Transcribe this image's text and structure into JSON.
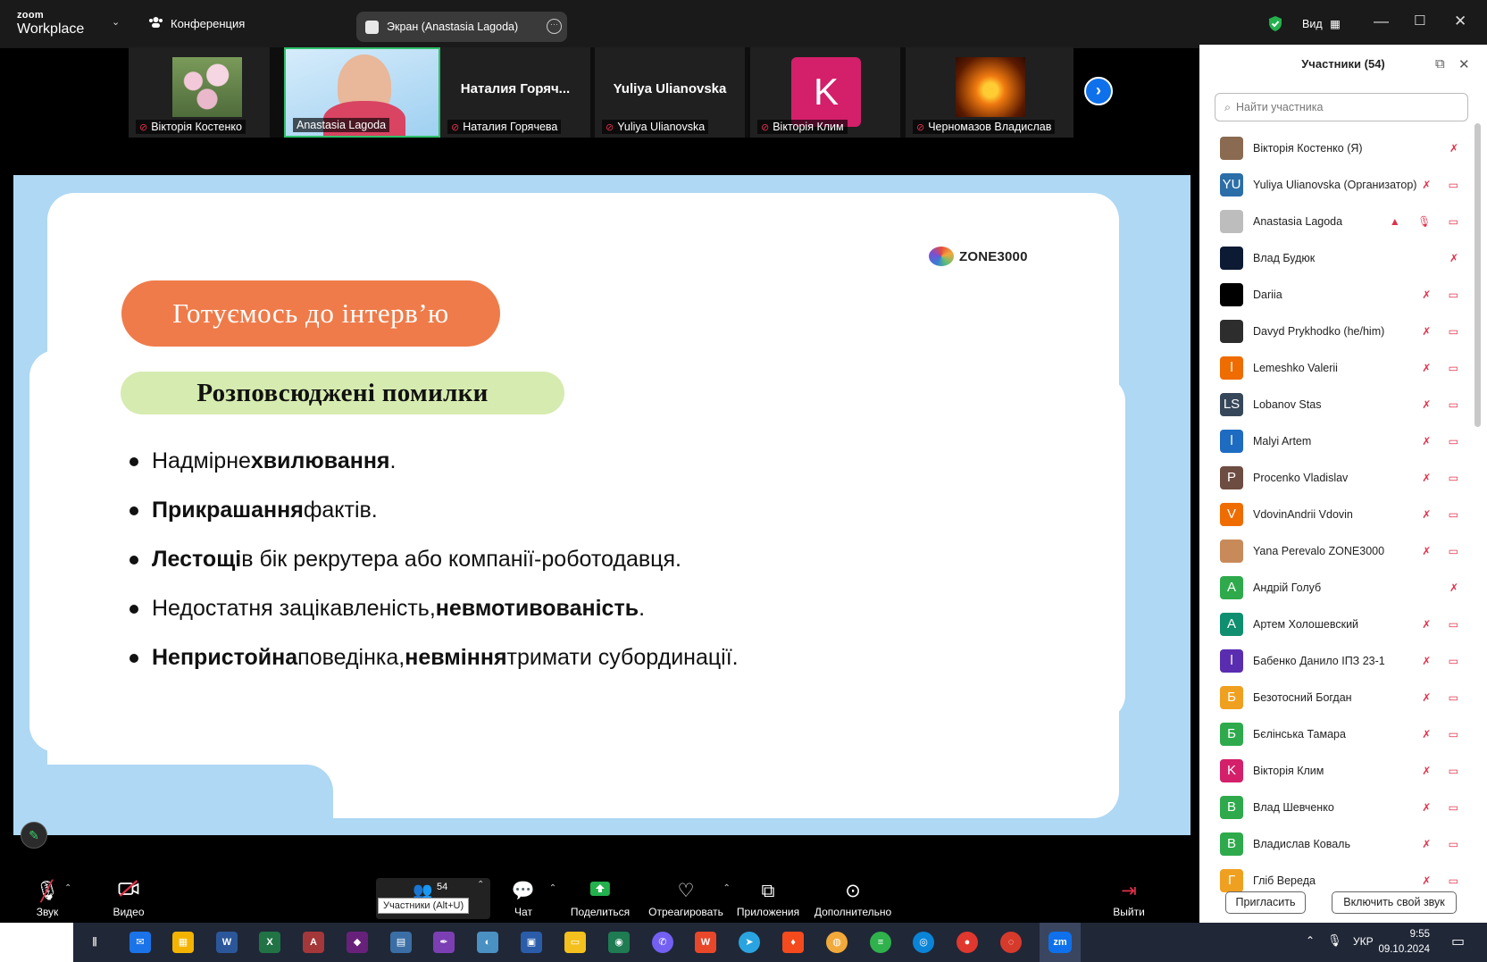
{
  "app": {
    "logo_top": "zoom",
    "logo_bottom": "Workplace",
    "conference": "Конференция",
    "screen_share": "Экран (Anastasia Lagoda)",
    "view_label": "Вид"
  },
  "strip": {
    "tiles": [
      {
        "name": "Вікторія Костенко"
      },
      {
        "name": "Anastasia Lagoda"
      },
      {
        "big": "Наталия  Горяч...",
        "name": "Наталия Горячева"
      },
      {
        "big": "Yuliya Ulianovska",
        "name": "Yuliya Ulianovska"
      },
      {
        "big": "K",
        "name": "Вікторія Клим"
      },
      {
        "name": "Черномазов Владислав"
      }
    ]
  },
  "slide": {
    "brand": "ZONE3000",
    "title": "Готуємось до інтерв’ю",
    "subtitle": "Розповсюджені помилки",
    "bullets": [
      {
        "b1": "",
        "t1": "Надмірне ",
        "b2": "хвилювання",
        "t2": ".",
        "b3": "",
        "t3": ""
      },
      {
        "b1": "Прикрашання",
        "t1": " фактів.",
        "b2": "",
        "t2": "",
        "b3": "",
        "t3": ""
      },
      {
        "b1": "Лестощі",
        "t1": " в бік рекрутера або компанії-роботодавця.",
        "b2": "",
        "t2": "",
        "b3": "",
        "t3": ""
      },
      {
        "b1": "",
        "t1": "Недостатня зацікавленість, ",
        "b2": "невмотивованість",
        "t2": ".",
        "b3": "",
        "t3": ""
      },
      {
        "b1": "Непристойна",
        "t1": " поведінка, ",
        "b2": "невміння",
        "t2": " тримати субординації.",
        "b3": "",
        "t3": ""
      }
    ]
  },
  "toolbar": {
    "audio": "Звук",
    "video": "Видео",
    "participants_count": "54",
    "participants_tooltip": "Участники (Alt+U)",
    "chat": "Чат",
    "share": "Поделиться",
    "react": "Отреагировать",
    "apps": "Приложения",
    "more": "Дополнительно",
    "leave": "Выйти"
  },
  "panel": {
    "title": "Участники (54)",
    "search_placeholder": "Найти участника",
    "invite": "Пригласить",
    "unmute_self": "Включить свой звук",
    "participants": [
      {
        "initials": "",
        "color": "#8a6a50",
        "name": "Вікторія Костенко (Я)",
        "icons": "✗"
      },
      {
        "initials": "YU",
        "color": "#2b6ea8",
        "name": "Yuliya Ulianovska (Организатор)",
        "icons": "✗ ▭"
      },
      {
        "initials": "",
        "color": "#bdbdbd",
        "name": "Anastasia Lagoda",
        "icons": "▲ 🎙 ▭"
      },
      {
        "initials": "",
        "color": "#0c1a33",
        "name": "Влад Будюк",
        "icons": "✗"
      },
      {
        "initials": "",
        "color": "#000000",
        "name": "Dariia",
        "icons": "✗ ▭"
      },
      {
        "initials": "",
        "color": "#2d2d2d",
        "name": "Davyd Prykhodko (he/him)",
        "icons": "✗ ▭"
      },
      {
        "initials": "l",
        "color": "#ef6c00",
        "name": "Lemeshko Valerii",
        "icons": "✗ ▭"
      },
      {
        "initials": "LS",
        "color": "#37475a",
        "name": "Lobanov Stas",
        "icons": "✗ ▭"
      },
      {
        "initials": "l",
        "color": "#1e6bc2",
        "name": "Malyi Artem",
        "icons": "✗ ▭"
      },
      {
        "initials": "P",
        "color": "#6d4c41",
        "name": "Procenko Vladislav",
        "icons": "✗ ▭"
      },
      {
        "initials": "V",
        "color": "#ef6c00",
        "name": "VdovinAndrii Vdovin",
        "icons": "✗ ▭"
      },
      {
        "initials": "",
        "color": "#c98a5a",
        "name": "Yana Perevalo ZONE3000",
        "icons": "✗ ▭"
      },
      {
        "initials": "A",
        "color": "#2eaa4c",
        "name": "Андрій Голуб",
        "icons": "✗"
      },
      {
        "initials": "A",
        "color": "#0f8f6f",
        "name": "Артем Холошевский",
        "icons": "✗ ▭"
      },
      {
        "initials": "l",
        "color": "#5a2db0",
        "name": "Бабенко Данило ІПЗ 23-1",
        "icons": "✗ ▭"
      },
      {
        "initials": "Б",
        "color": "#f0a020",
        "name": "Безотосний Богдан",
        "icons": "✗ ▭"
      },
      {
        "initials": "Б",
        "color": "#2eaa4c",
        "name": "Бєлінська Тамара",
        "icons": "✗ ▭"
      },
      {
        "initials": "K",
        "color": "#d41f6a",
        "name": "Вікторія Клим",
        "icons": "✗ ▭"
      },
      {
        "initials": "B",
        "color": "#2eaa4c",
        "name": "Влад Шевченко",
        "icons": "✗ ▭"
      },
      {
        "initials": "B",
        "color": "#2eaa4c",
        "name": "Владислав Коваль",
        "icons": "✗ ▭"
      },
      {
        "initials": "Г",
        "color": "#f0a020",
        "name": "Гліб Вереда",
        "icons": "✗ ▭"
      }
    ]
  },
  "taskbar": {
    "lang": "УКР",
    "time": "9:55",
    "date": "09.10.2024",
    "zoom_label": "zm"
  },
  "colors": {
    "accent": "#0e71eb",
    "slide_bg": "#aed8f3",
    "title_pill": "#ef7b4a",
    "subtitle_pill": "#d6ebb0",
    "mute": "#e0304a"
  }
}
